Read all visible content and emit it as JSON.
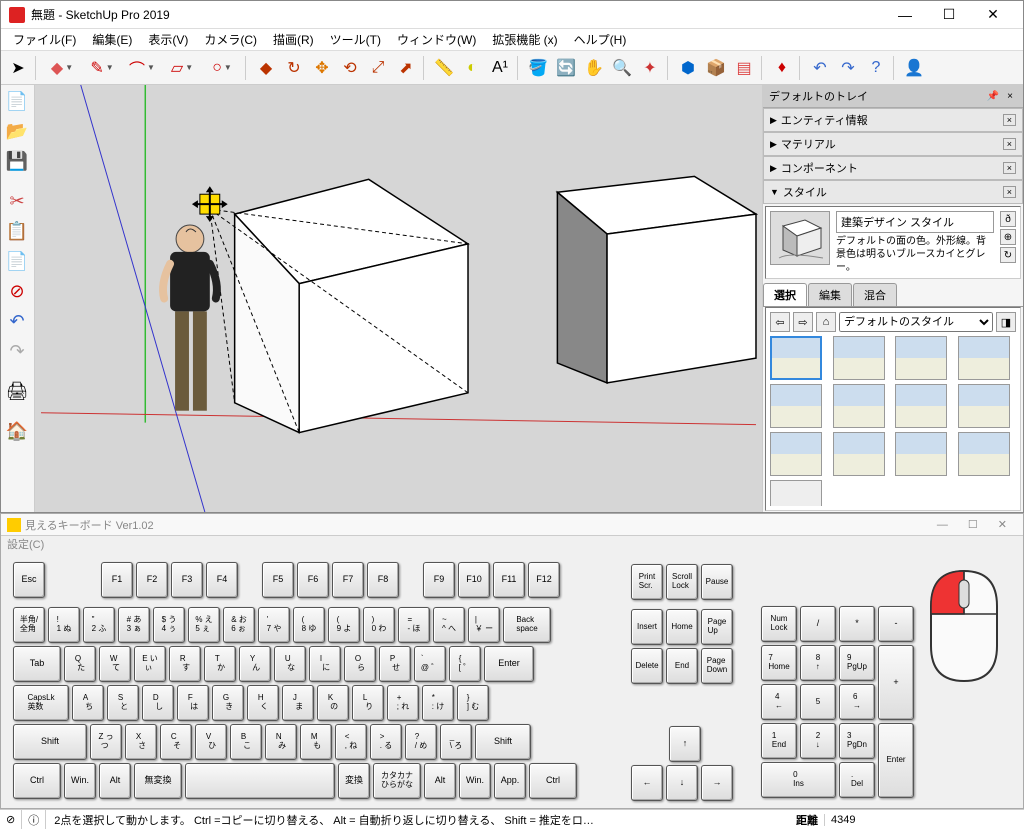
{
  "sketchup": {
    "title": "無題 - SketchUp Pro 2019",
    "menu": [
      "ファイル(F)",
      "編集(E)",
      "表示(V)",
      "カメラ(C)",
      "描画(R)",
      "ツール(T)",
      "ウィンドウ(W)",
      "拡張機能 (x)",
      "ヘルプ(H)"
    ],
    "tray": {
      "title": "デフォルトのトレイ",
      "panels": [
        "エンティティ情報",
        "マテリアル",
        "コンポーネント",
        "スタイル"
      ],
      "style": {
        "name": "建築デザイン スタイル",
        "desc": "デフォルトの面の色。外形線。背景色は明るいブルースカイとグレー。",
        "tabs": [
          "選択",
          "編集",
          "混合"
        ],
        "dropdown": "デフォルトのスタイル"
      }
    }
  },
  "keyboard": {
    "title": "見えるキーボード Ver1.02",
    "menu": "設定(C)",
    "row_fn": [
      "Esc",
      "",
      "F1",
      "F2",
      "F3",
      "F4",
      "",
      "F5",
      "F6",
      "F7",
      "F8",
      "",
      "F9",
      "F10",
      "F11",
      "F12"
    ],
    "cluster1": [
      "Print\nScr.",
      "Scroll\nLock",
      "Pause"
    ],
    "row1": [
      "半角/\n全角",
      "!\n1 ぬ",
      "\"\n2 ふ",
      "# あ\n3 ぁ",
      "$ う\n4 ぅ",
      "% え\n5 ぇ",
      "& お\n6 ぉ",
      "'\n7 や",
      "(\n8 ゆ",
      "(\n9 よ",
      ")\n0 わ",
      "=\n- ほ",
      "~\n^ へ",
      "|\n￥ ー",
      "Back\nspace"
    ],
    "cluster2": [
      "Insert",
      "Home",
      "Page\nUp"
    ],
    "row2": [
      "Tab",
      "Q\n た",
      "W\n て",
      "E い\n ぃ",
      "R\n す",
      "T\n か",
      "Y\n ん",
      "U\n な",
      "I\n に",
      "O\n ら",
      "P\n せ",
      "`\n@ ゛",
      "{\n[ ゜",
      "Enter"
    ],
    "cluster3": [
      "Delete",
      "End",
      "Page\nDown"
    ],
    "row3": [
      "CapsLk\n英数",
      "A\n ち",
      "S\n と",
      "D\n し",
      "F\n は",
      "G\n き",
      "H\n く",
      "J\n ま",
      "K\n の",
      "L\n り",
      "+\n; れ",
      "*\n: け",
      "}\n] む"
    ],
    "row4": [
      "Shift",
      "Z っ\n つ",
      "X\n さ",
      "C\n そ",
      "V\n ひ",
      "B\n こ",
      "N\n み",
      "M\n も",
      "<\n, ね",
      ">\n. る",
      "?\n/ め",
      "_\n\\ ろ",
      "Shift"
    ],
    "row5": [
      "Ctrl",
      "Win.",
      "Alt",
      "無変換",
      "",
      "変換",
      "カタカナ\nひらがな",
      "Alt",
      "Win.",
      "App.",
      "Ctrl"
    ],
    "arrows": [
      "↑",
      "←",
      "↓",
      "→"
    ],
    "numpad": [
      "Num\nLock",
      "/",
      "*",
      "-",
      "7\nHome",
      "8\n↑",
      "9\nPgUp",
      "+",
      "4\n←",
      "5",
      "6\n→",
      "1\nEnd",
      "2\n↓",
      "3\nPgDn",
      "Enter",
      "0\nIns",
      ".\nDel"
    ]
  },
  "status": {
    "hint": "2点を選択して動かします。 Ctrl =コピーに切り替える、 Alt = 自動折り返しに切り替える、 Shift = 推定をロ…",
    "dist_label": "距離",
    "dist_value": "4349"
  }
}
